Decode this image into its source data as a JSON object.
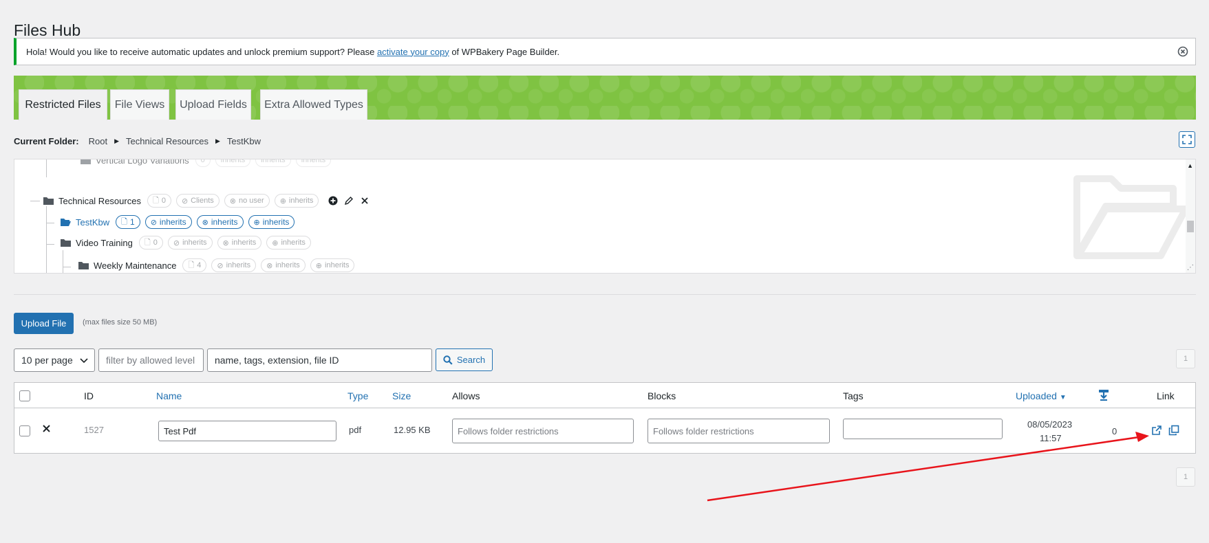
{
  "page": {
    "title": "Files Hub"
  },
  "notice": {
    "text_before": "Hola! Would you like to receive automatic updates and unlock premium support? Please ",
    "link_text": "activate your copy",
    "text_after": " of WPBakery Page Builder."
  },
  "tabs": [
    {
      "label": "Restricted Files",
      "active": true
    },
    {
      "label": "File Views",
      "active": false
    },
    {
      "label": "Upload Fields",
      "active": false
    },
    {
      "label": "Extra Allowed Types",
      "active": false
    }
  ],
  "breadcrumb": {
    "label": "Current Folder:",
    "items": [
      "Root",
      "Technical Resources",
      "TestKbw"
    ]
  },
  "tree": {
    "partial_top": {
      "name": "Vertical Logo Variations",
      "count": "0",
      "allow": "inherits",
      "block": "inherits",
      "download": "inherits"
    },
    "rows": [
      {
        "name": "Technical Resources",
        "count": "0",
        "allow": "Clients",
        "block": "no user",
        "download": "inherits",
        "current": false
      },
      {
        "name": "TestKbw",
        "count": "1",
        "allow": "inherits",
        "block": "inherits",
        "download": "inherits",
        "current": true
      },
      {
        "name": "Video Training",
        "count": "0",
        "allow": "inherits",
        "block": "inherits",
        "download": "inherits",
        "current": false
      },
      {
        "name": "Weekly Maintenance",
        "count": "4",
        "allow": "inherits",
        "block": "inherits",
        "download": "inherits",
        "current": false
      }
    ]
  },
  "upload": {
    "button_label": "Upload File",
    "max_note": "(max files size 50 MB)"
  },
  "filters": {
    "per_page": "10 per page",
    "level_placeholder": "filter by allowed level",
    "search_value": "name, tags, extension, file ID",
    "search_button": "Search"
  },
  "pagination": {
    "top": "1",
    "bottom": "1"
  },
  "table": {
    "headers": {
      "id": "ID",
      "name": "Name",
      "type": "Type",
      "size": "Size",
      "allows": "Allows",
      "blocks": "Blocks",
      "tags": "Tags",
      "uploaded": "Uploaded",
      "link": "Link"
    },
    "rows": [
      {
        "id": "1527",
        "name": "Test Pdf",
        "type": "pdf",
        "size": "12.95 KB",
        "allows_placeholder": "Follows folder restrictions",
        "blocks_placeholder": "Follows folder restrictions",
        "tags": "",
        "uploaded_date": "08/05/2023",
        "uploaded_time": "11:57",
        "downloads": "0"
      }
    ]
  },
  "colors": {
    "accent": "#2271b1",
    "tabs_band": "#7fc342",
    "notice_border": "#00a32a",
    "annotation_arrow": "#e8141b"
  }
}
